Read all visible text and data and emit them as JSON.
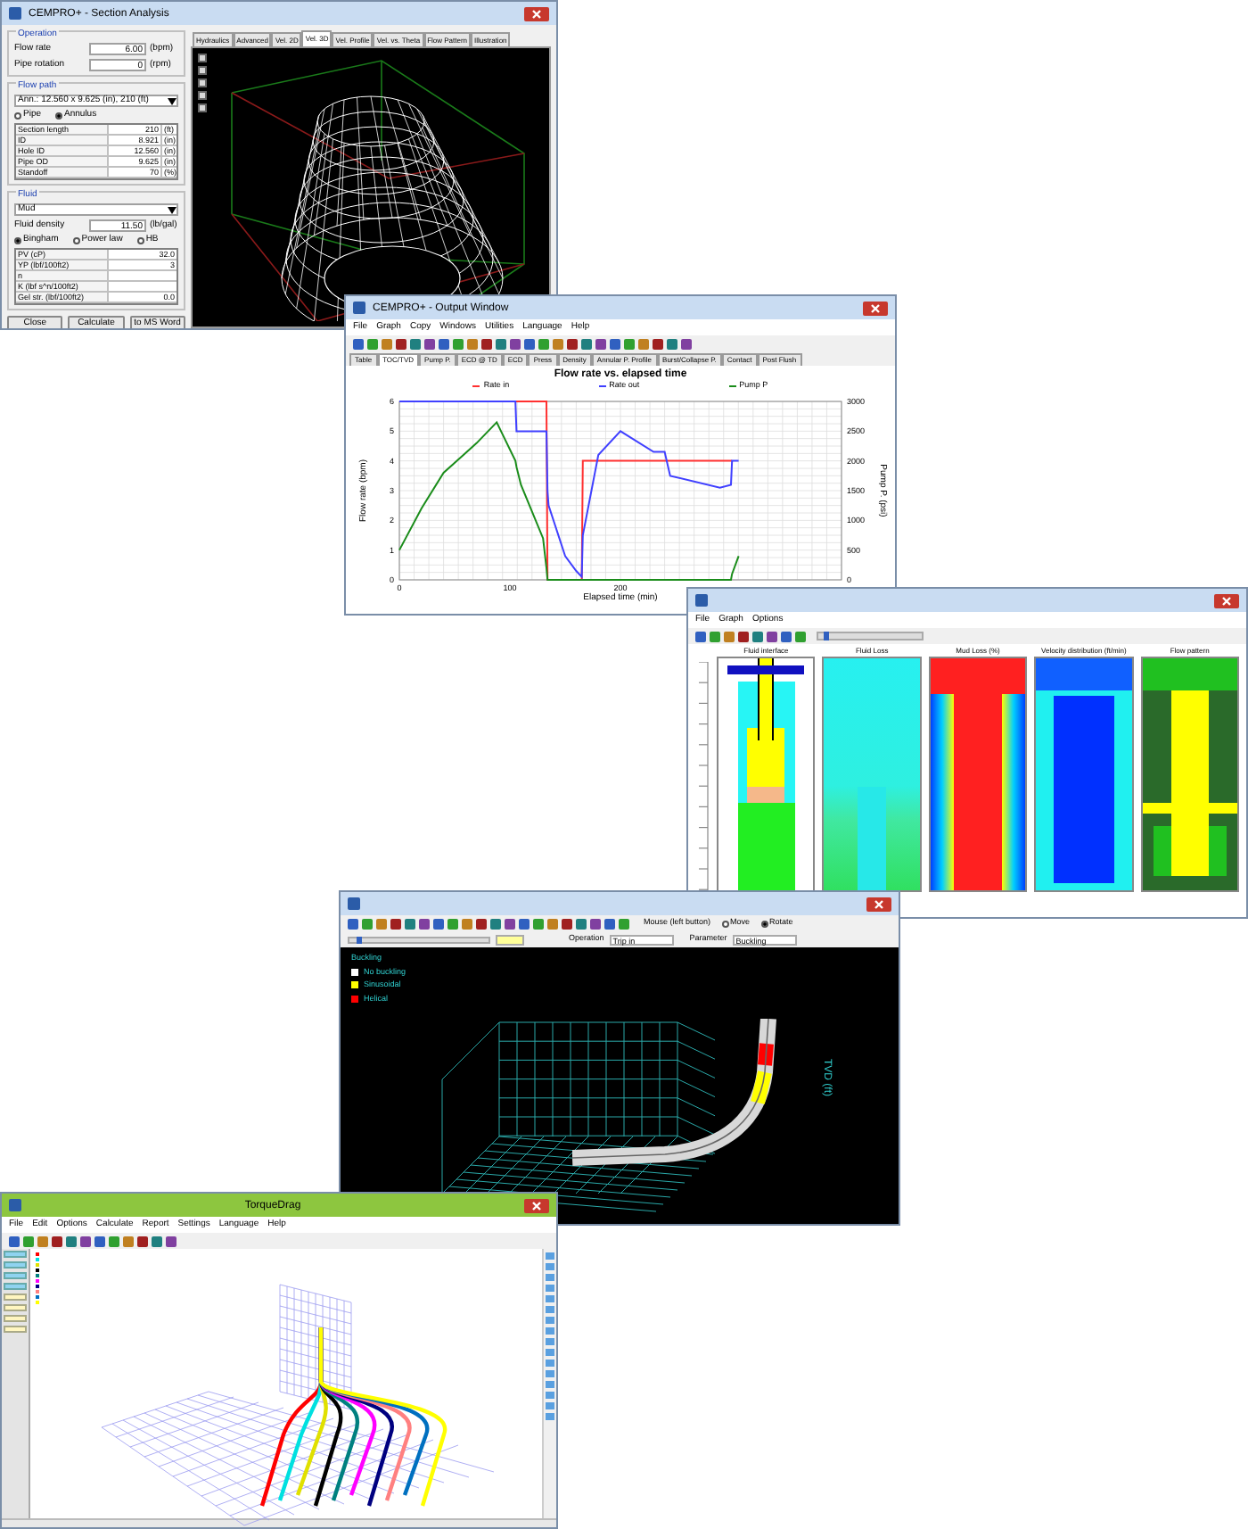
{
  "section_analysis": {
    "title": "CEMPRO+ - Section Analysis",
    "operation": {
      "legend": "Operation",
      "fields": [
        {
          "label": "Flow rate",
          "value": "6.00",
          "unit": "(bpm)"
        },
        {
          "label": "Pipe rotation",
          "value": "0",
          "unit": "(rpm)"
        }
      ]
    },
    "flow_path": {
      "legend": "Flow path",
      "dropdown": "Ann.: 12.560 x 9.625 (in), 210 (ft)",
      "radios": [
        {
          "label": "Pipe",
          "selected": false
        },
        {
          "label": "Annulus",
          "selected": true
        }
      ],
      "rows": [
        {
          "label": "Section length",
          "value": "210",
          "unit": "(ft)"
        },
        {
          "label": "ID",
          "value": "8.921",
          "unit": "(in)"
        },
        {
          "label": "Hole ID",
          "value": "12.560",
          "unit": "(in)"
        },
        {
          "label": "Pipe OD",
          "value": "9.625",
          "unit": "(in)"
        },
        {
          "label": "Standoff",
          "value": "70",
          "unit": "(%)"
        }
      ]
    },
    "fluid": {
      "legend": "Fluid",
      "dropdown": "Mud",
      "density": {
        "label": "Fluid density",
        "value": "11.50",
        "unit": "(lb/gal)"
      },
      "radios": [
        {
          "label": "Bingham",
          "selected": true
        },
        {
          "label": "Power law",
          "selected": false
        },
        {
          "label": "HB",
          "selected": false
        }
      ],
      "rows": [
        {
          "label": "PV (cP)",
          "value": "32.0"
        },
        {
          "label": "YP (lbf/100ft2)",
          "value": "3"
        },
        {
          "label": "n",
          "value": ""
        },
        {
          "label": "K (lbf s^n/100ft2)",
          "value": ""
        },
        {
          "label": "Gel str. (lbf/100ft2)",
          "value": "0.0"
        }
      ]
    },
    "buttons": [
      "Close",
      "Calculate",
      "to MS Word"
    ],
    "tabs": [
      {
        "label": "Hydraulics",
        "selected": false
      },
      {
        "label": "Advanced",
        "selected": false
      },
      {
        "label": "Vel. 2D",
        "selected": false
      },
      {
        "label": "Vel. 3D",
        "selected": true
      },
      {
        "label": "Vel. Profile",
        "selected": false
      },
      {
        "label": "Vel. vs. Theta",
        "selected": false
      },
      {
        "label": "Flow Pattern",
        "selected": false
      },
      {
        "label": "Illustration",
        "selected": false
      }
    ]
  },
  "output_window": {
    "title": "CEMPRO+ - Output Window",
    "menu": [
      "File",
      "Graph",
      "Copy",
      "Windows",
      "Utilities",
      "Language",
      "Help"
    ],
    "tabs": [
      {
        "label": "Table",
        "selected": false
      },
      {
        "label": "TOC/TVD",
        "selected": true
      },
      {
        "label": "Pump P.",
        "selected": false
      },
      {
        "label": "ECD @ TD",
        "selected": false
      },
      {
        "label": "ECD",
        "selected": false
      },
      {
        "label": "Press",
        "selected": false
      },
      {
        "label": "Density",
        "selected": false
      },
      {
        "label": "Annular P. Profile",
        "selected": false
      },
      {
        "label": "Burst/Collapse P.",
        "selected": false
      },
      {
        "label": "Contact",
        "selected": false
      },
      {
        "label": "Post Flush",
        "selected": false
      }
    ],
    "chart_data": {
      "type": "line",
      "title": "Flow rate vs. elapsed time",
      "xlabel": "Elapsed time (min)",
      "ylabel": "Flow rate (bpm)",
      "y2label": "Pump P. (psi)",
      "x": [
        0,
        20,
        40,
        70,
        88,
        105,
        106,
        110,
        130,
        133,
        134,
        135,
        150,
        160,
        165,
        166,
        180,
        200,
        230,
        240,
        245,
        290,
        300,
        301,
        307
      ],
      "series": [
        {
          "name": "Rate in",
          "color": "#ff3030",
          "values": [
            null,
            null,
            null,
            null,
            null,
            6,
            6,
            6,
            6,
            6,
            0,
            0,
            0,
            0,
            0,
            4,
            4,
            4,
            4,
            4,
            4,
            4,
            4,
            4,
            null
          ]
        },
        {
          "name": "Rate out",
          "color": "#4040ff",
          "values": [
            6,
            6,
            6,
            6,
            6,
            6,
            5,
            5,
            5,
            5,
            3,
            2.5,
            0.8,
            0.3,
            0.1,
            1.5,
            4.2,
            5,
            4.3,
            4.3,
            3.5,
            3.1,
            3.2,
            4,
            4
          ]
        },
        {
          "name": "Pump P",
          "color": "#1a8c1a",
          "axis": "y2",
          "values": [
            500,
            1200,
            1800,
            2300,
            2650,
            2000,
            1900,
            1600,
            700,
            200,
            0,
            0,
            0,
            0,
            0,
            0,
            0,
            0,
            0,
            0,
            0,
            0,
            0,
            100,
            400
          ]
        }
      ],
      "xlim": [
        0,
        400
      ],
      "ylim": [
        0,
        6
      ],
      "y2lim": [
        0,
        3000
      ],
      "xticks": [
        0,
        100,
        200
      ],
      "yticks": [
        0,
        1,
        2,
        3,
        4,
        5,
        6
      ],
      "grid": true,
      "legend": "top",
      "y2ticks": [
        0,
        500,
        1000,
        1500,
        2000,
        2500,
        3000
      ]
    }
  },
  "profile_window": {
    "menu": [
      "File",
      "Graph",
      "Options"
    ],
    "slider": {
      "level": 0.05
    },
    "panels": [
      {
        "title": "Fluid interface",
        "kind": "interface"
      },
      {
        "title": "Fluid Loss",
        "kind": "loss"
      },
      {
        "title": "Mud Loss (%)",
        "kind": "mudloss"
      },
      {
        "title": "Velocity distribution (ft/min)",
        "kind": "velocity"
      },
      {
        "title": "Flow pattern",
        "kind": "pattern"
      }
    ]
  },
  "buckling_window": {
    "slider": {
      "level": 0.05
    },
    "operation_label": "Operation",
    "operation": "Trip in",
    "parameter_label": "Parameter",
    "parameter": "Buckling",
    "mouse_label": "Mouse (left button)",
    "radios": [
      {
        "label": "Move",
        "selected": false
      },
      {
        "label": "Rotate",
        "selected": true
      }
    ],
    "legend_title": "Buckling",
    "legend": [
      {
        "label": "No buckling",
        "color": "#ffffff"
      },
      {
        "label": "Sinusoidal",
        "color": "#ffff00"
      },
      {
        "label": "Helical",
        "color": "#ff0000"
      }
    ],
    "axis_label": "TVD (ft)"
  },
  "survey_window": {
    "title": "TorqueDrag",
    "menu": [
      "File",
      "Edit",
      "Options",
      "Calculate",
      "Report",
      "Settings",
      "Language",
      "Help"
    ],
    "wells": [
      {
        "color": "#ff0000"
      },
      {
        "color": "#00e0e0"
      },
      {
        "color": "#e0e000"
      },
      {
        "color": "#000000"
      },
      {
        "color": "#008080"
      },
      {
        "color": "#ff00ff"
      },
      {
        "color": "#000080"
      },
      {
        "color": "#ff8080"
      },
      {
        "color": "#0070c0"
      },
      {
        "color": "#ffff00"
      }
    ]
  }
}
